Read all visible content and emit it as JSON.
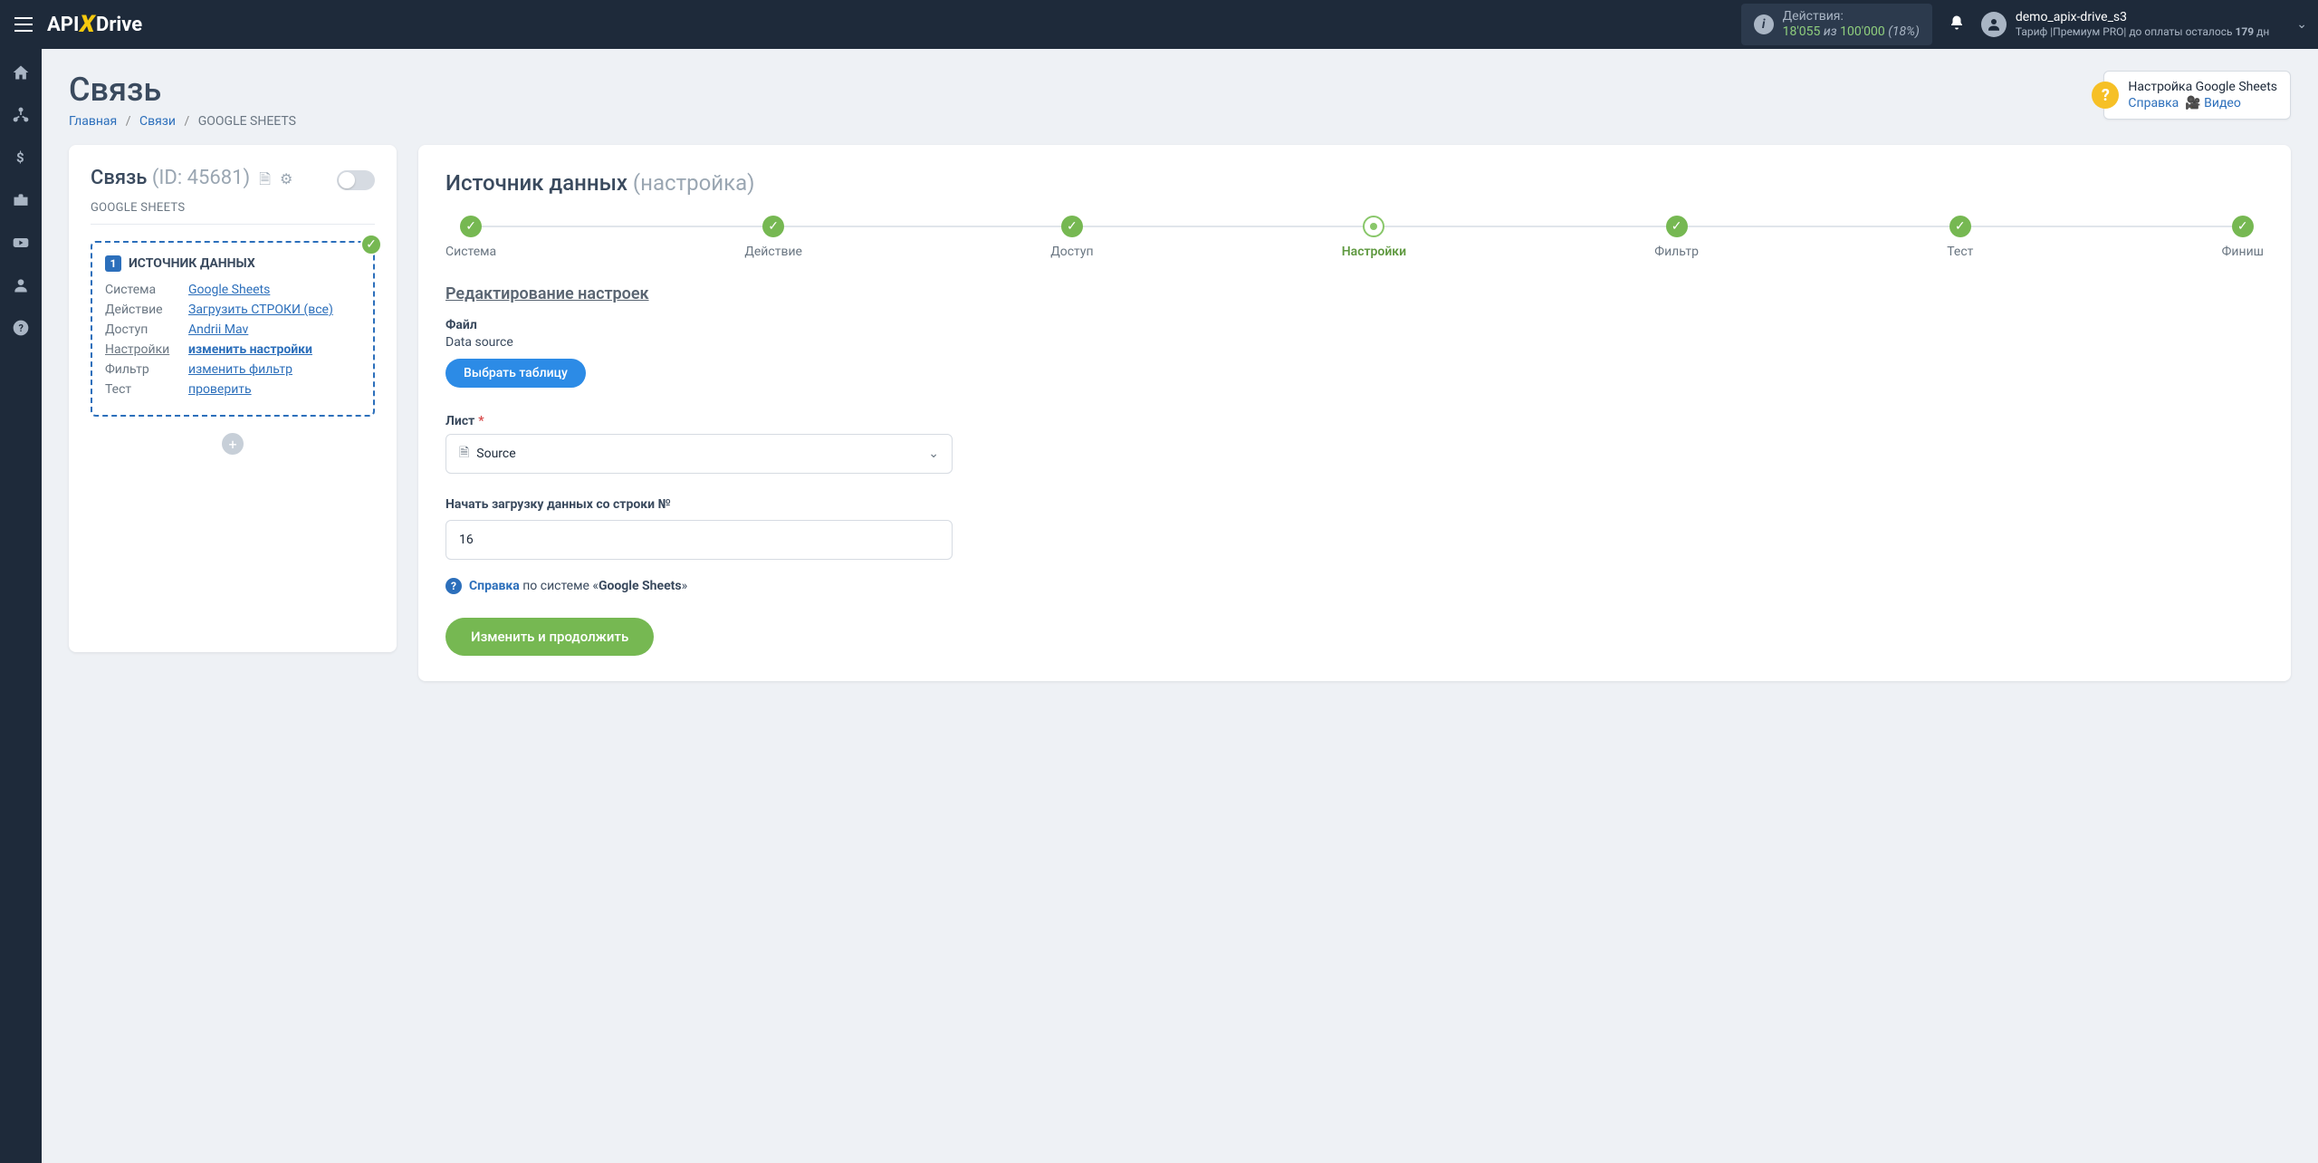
{
  "header": {
    "logo_a": "API",
    "logo_b": "Drive",
    "actions_label": "Действия:",
    "actions_used": "18'055",
    "actions_of": "из",
    "actions_total": "100'000",
    "actions_pct": "(18%)",
    "username": "demo_apix-drive_s3",
    "tariff_prefix": "Тариф |Премиум PRO| до оплаты осталось ",
    "tariff_days": "179",
    "tariff_suffix": " дн"
  },
  "page": {
    "title": "Связь",
    "crumb_home": "Главная",
    "crumb_links": "Связи",
    "crumb_current": "GOOGLE SHEETS"
  },
  "help": {
    "title": "Настройка Google Sheets",
    "ref": "Справка",
    "video": "Видео"
  },
  "left": {
    "title": "Связь",
    "id_label": "(ID: 45681)",
    "system_label": "GOOGLE SHEETS",
    "box_title": "ИСТОЧНИК ДАННЫХ",
    "rows": {
      "system_k": "Система",
      "system_v": "Google Sheets",
      "action_k": "Действие",
      "action_v": "Загрузить СТРОКИ (все)",
      "access_k": "Доступ",
      "access_v": "Andrii Mav",
      "settings_k": "Настройки",
      "settings_v": "изменить настройки",
      "filter_k": "Фильтр",
      "filter_v": "изменить фильтр",
      "test_k": "Тест",
      "test_v": "проверить"
    }
  },
  "right": {
    "title_main": "Источник данных",
    "title_sub": "(настройка)",
    "steps": {
      "s1": "Система",
      "s2": "Действие",
      "s3": "Доступ",
      "s4": "Настройки",
      "s5": "Фильтр",
      "s6": "Тест",
      "s7": "Финиш"
    },
    "section": "Редактирование настроек",
    "file_label": "Файл",
    "file_value": "Data source",
    "choose_table": "Выбрать таблицу",
    "sheet_label": "Лист",
    "sheet_value": "Source",
    "row_label": "Начать загрузку данных со строки №",
    "row_value": "16",
    "help_prefix": "Справка",
    "help_mid": " по системе «",
    "help_sys": "Google Sheets",
    "help_suffix": "»",
    "submit": "Изменить и продолжить"
  }
}
